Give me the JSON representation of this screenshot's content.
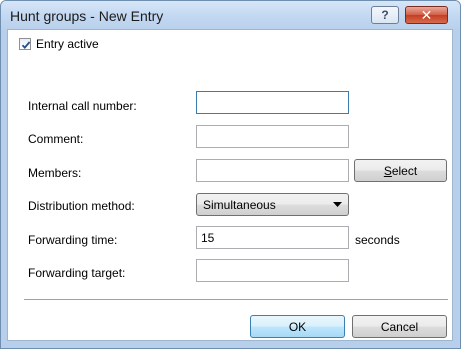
{
  "window": {
    "title": "Hunt groups - New Entry",
    "help_icon": "question-mark-icon",
    "help_glyph": "?",
    "close_icon": "close-icon",
    "close_glyph": "✕"
  },
  "form": {
    "entry_active": {
      "label": "Entry active",
      "checked": true
    },
    "internal_call_number": {
      "label": "Internal call number:",
      "value": ""
    },
    "comment": {
      "label": "Comment:",
      "value": ""
    },
    "members": {
      "label": "Members:",
      "value": "",
      "select_button": "Select"
    },
    "distribution_method": {
      "label": "Distribution method:",
      "selected": "Simultaneous"
    },
    "forwarding_time": {
      "label": "Forwarding time:",
      "value": "15",
      "unit": "seconds"
    },
    "forwarding_target": {
      "label": "Forwarding target:",
      "value": ""
    }
  },
  "buttons": {
    "ok": "OK",
    "cancel": "Cancel"
  },
  "colors": {
    "accent": "#3c7fb1",
    "titlebar": "#c3d8f1",
    "close": "#c13f22"
  }
}
